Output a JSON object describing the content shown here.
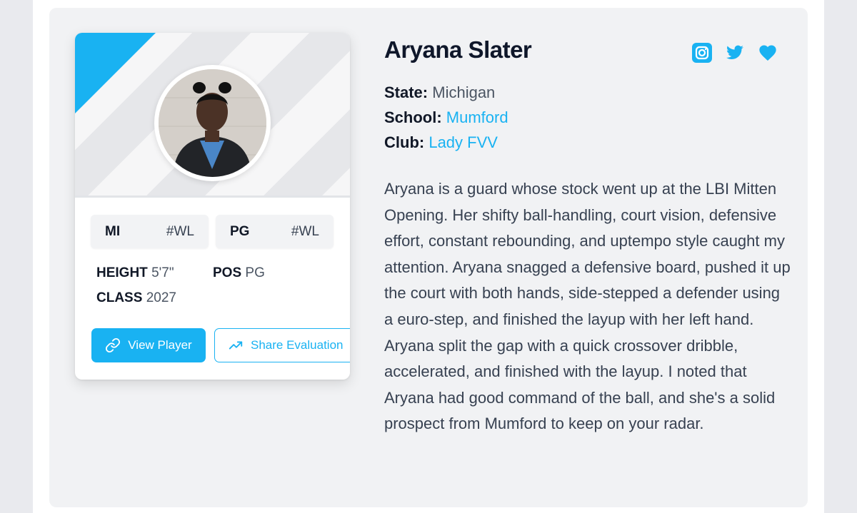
{
  "player": {
    "name": "Aryana Slater",
    "state_label": "State:",
    "state": "Michigan",
    "school_label": "School:",
    "school": "Mumford",
    "club_label": "Club:",
    "club": "Lady FVV",
    "bio": "Aryana is a guard whose stock went up at the LBI Mitten Opening. Her shifty ball-handling, court vision, defensive effort, constant rebounding, and uptempo style caught my attention. Aryana snagged a defensive board, pushed it up the court with both hands, side-stepped a defender using a euro-step, and finished the layup with her left hand. Aryana split the gap with a quick crossover dribble, accelerated, and finished with the layup. I noted that Aryana had good command of the ball, and she's a solid prospect from Mumford to keep on your radar."
  },
  "card": {
    "tags": [
      {
        "code": "MI",
        "rank": "#WL"
      },
      {
        "code": "PG",
        "rank": "#WL"
      }
    ],
    "height_label": "HEIGHT",
    "height": "5'7\"",
    "pos_label": "POS",
    "pos": "PG",
    "class_label": "CLASS",
    "class": "2027",
    "view_button": "View Player",
    "share_button": "Share Evaluation"
  },
  "icons": {
    "social": [
      "instagram-icon",
      "twitter-icon",
      "heart-icon"
    ],
    "view": "link-icon",
    "share": "trending-up-icon"
  },
  "colors": {
    "accent": "#19b2f2",
    "panel": "#f1f2f4",
    "text": "#374151",
    "heading": "#0f172a"
  }
}
